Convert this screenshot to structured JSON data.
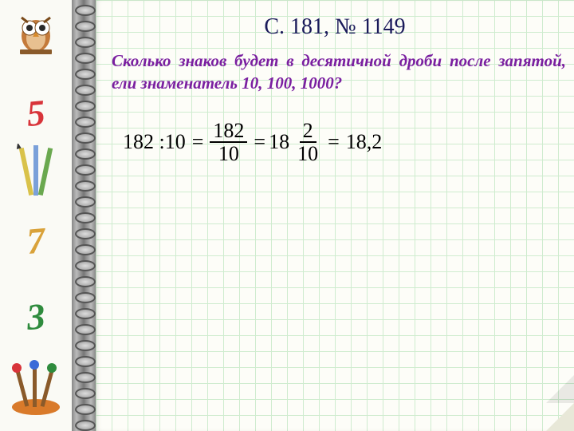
{
  "sidebar": {
    "num5": "5",
    "num7": "7",
    "num3": "3"
  },
  "title": "С. 181, № 1149",
  "question": "Сколько знаков будет в десятичной дроби после запятой, ели знаменатель 10, 100, 1000?",
  "equation": {
    "lhs": "182 :10",
    "eq": "=",
    "frac1_num": "182",
    "frac1_den": "10",
    "mixed_whole": "18",
    "mixed_num": "2",
    "mixed_den": "10",
    "result": "18,2"
  }
}
